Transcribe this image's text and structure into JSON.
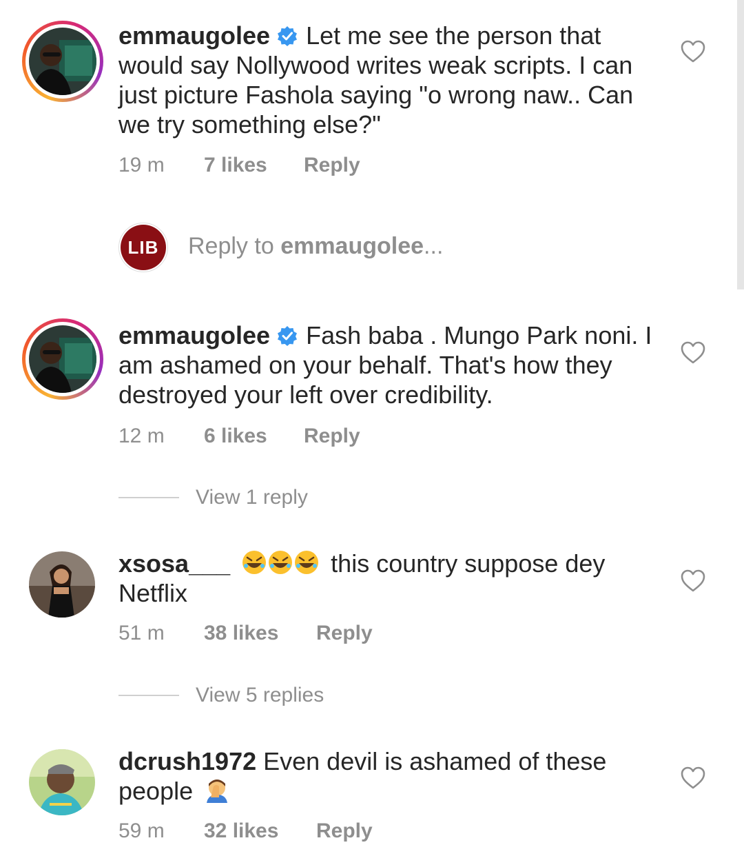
{
  "colors": {
    "text": "#262626",
    "muted": "#8e8e8e",
    "verified": "#3897f0",
    "lib_brand": "#8a0f14"
  },
  "comments": [
    {
      "username": "emmaugolee",
      "verified": true,
      "text": "Let me see the person that would say Nollywood writes weak scripts. I can just picture Fashola saying \"o wrong naw.. Can we try something else?\"",
      "time": "19 m",
      "likes": "7 likes",
      "reply_label": "Reply",
      "avatar_icon": "profile-avatar-story-ring"
    },
    {
      "username": "emmaugolee",
      "verified": true,
      "text": "Fash baba . Mungo Park noni. I am ashamed on your behalf. That's how they destroyed your left over credibility.",
      "time": "12 m",
      "likes": "6 likes",
      "reply_label": "Reply",
      "view_replies": "View 1 reply",
      "avatar_icon": "profile-avatar-story-ring"
    },
    {
      "username": "xsosa___",
      "verified": false,
      "text_before_emoji": "",
      "text": "this country suppose dey Netflix",
      "emojis": "rolling-on-floor-laughing x3",
      "time": "51 m",
      "likes": "38 likes",
      "reply_label": "Reply",
      "view_replies": "View 5 replies",
      "avatar_icon": "profile-avatar"
    },
    {
      "username": "dcrush1972",
      "verified": false,
      "text": "Even devil is ashamed of these people",
      "emojis": "face-palm",
      "time": "59 m",
      "likes": "32 likes",
      "reply_label": "Reply",
      "avatar_icon": "profile-avatar"
    }
  ],
  "reply_box": {
    "logo_text": "LIB",
    "prefix": "Reply to ",
    "target": "emmaugolee",
    "suffix": "..."
  }
}
